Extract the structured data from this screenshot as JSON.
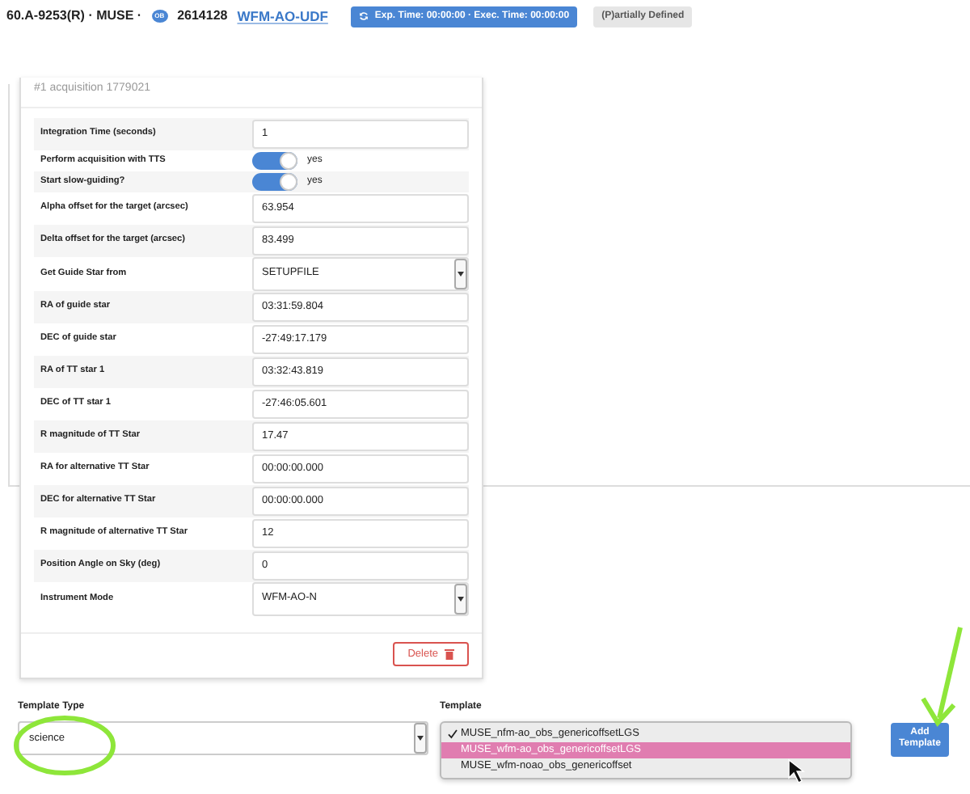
{
  "header": {
    "proposal": "60.A-9253(R) · MUSE ·",
    "ob_badge": "OB",
    "ob_id": "2614128",
    "ob_name": "WFM-AO-UDF",
    "time_badge": "Exp. Time: 00:00:00 · Exec. Time: 00:00:00",
    "status": "(P)artially Defined"
  },
  "card": {
    "title": "#1 acquisition 1779021",
    "params": [
      {
        "kind": "text",
        "label": "Integration Time (seconds)",
        "value": "1"
      },
      {
        "kind": "toggle",
        "label": "Perform acquisition with TTS",
        "on": true,
        "value": "yes"
      },
      {
        "kind": "toggle",
        "label": "Start slow-guiding?",
        "on": true,
        "value": "yes"
      },
      {
        "kind": "text",
        "label": "Alpha offset for the target (arcsec)",
        "value": "63.954"
      },
      {
        "kind": "text",
        "label": "Delta offset for the target (arcsec)",
        "value": "83.499"
      },
      {
        "kind": "select",
        "label": "Get Guide Star from",
        "value": "SETUPFILE"
      },
      {
        "kind": "text",
        "label": "RA of guide star",
        "value": "03:31:59.804"
      },
      {
        "kind": "text",
        "label": "DEC of guide star",
        "value": "-27:49:17.179"
      },
      {
        "kind": "text",
        "label": "RA of TT star 1",
        "value": "03:32:43.819"
      },
      {
        "kind": "text",
        "label": "DEC of TT star 1",
        "value": "-27:46:05.601"
      },
      {
        "kind": "text",
        "label": "R magnitude of TT Star",
        "value": "17.47"
      },
      {
        "kind": "text",
        "label": "RA for alternative TT Star",
        "value": "00:00:00.000"
      },
      {
        "kind": "text",
        "label": "DEC for alternative TT Star",
        "value": "00:00:00.000"
      },
      {
        "kind": "text",
        "label": "R magnitude of alternative TT Star",
        "value": "12"
      },
      {
        "kind": "text",
        "label": "Position Angle on Sky (deg)",
        "value": "0"
      },
      {
        "kind": "select",
        "label": "Instrument Mode",
        "value": "WFM-AO-N"
      }
    ],
    "delete_button": "Delete"
  },
  "template_type": {
    "label": "Template Type",
    "value": "science"
  },
  "template": {
    "label": "Template",
    "options": [
      {
        "label": "MUSE_nfm-ao_obs_genericoffsetLGS",
        "checked": true,
        "selected": false
      },
      {
        "label": "MUSE_wfm-ao_obs_genericoffsetLGS",
        "checked": false,
        "selected": true
      },
      {
        "label": "MUSE_wfm-noao_obs_genericoffset",
        "checked": false,
        "selected": false
      }
    ]
  },
  "add_button": "Add Template"
}
